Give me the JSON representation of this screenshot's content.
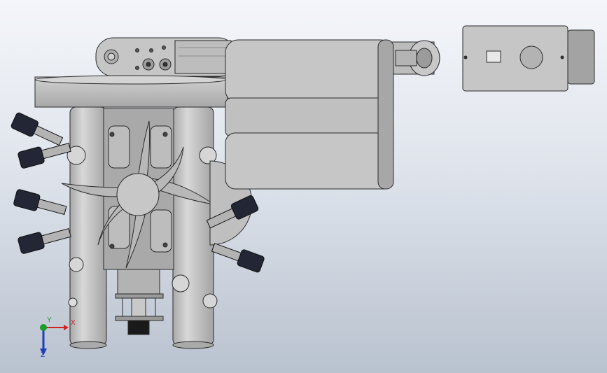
{
  "viewport": {
    "background_top": "#f4f6fa",
    "background_bottom": "#b9c2cf",
    "part_fill": "#c4c4c4",
    "part_dark": "#9a9a9a",
    "edge_color": "#2a2a2a",
    "connector_color": "#20222e"
  },
  "triad": {
    "x_label": "X",
    "y_label": "Y",
    "z_label": "Z",
    "x_color": "#d21f1f",
    "y_color": "#1e9a2a",
    "z_color": "#1d3fb8"
  }
}
